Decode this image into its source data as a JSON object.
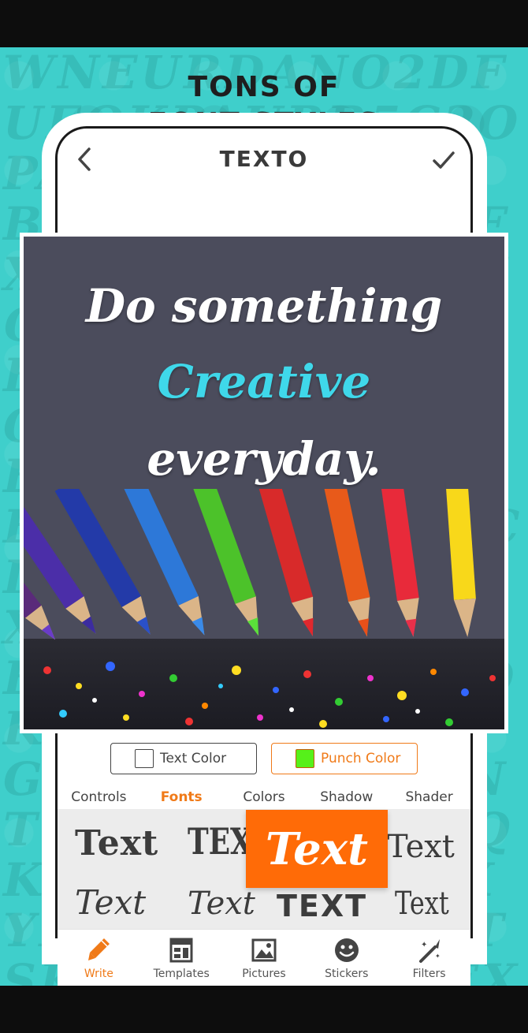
{
  "promo": {
    "headline_line1": "TONS OF",
    "headline_line2": "FONT STYLES",
    "background_letters": "WNEURDANO2DFUEOKPAURB5C2OPAURBSWGHEFABKXSWGHONEBFXYRACFBBXYHTFQEKFUEOGHSWABPLDKNERTIAUCOHRPYSHQBZ2NEOMAVPXGACLTIESKYSPINQUNWCDEOABVMLZIJOEXPTGSQCDAZIOVESCFRHMCXBLJQKPMTEGOWYAJXGEFTZAIRHGCVNTQGWMBRYHTFQKOCLZKHEWBFXYRACFBBXEFTDTSKCEFHLWLNSEXAWRBNUSKPXFCDODOPXQAOGHCDQHRKAMXBWFHRAZPYTEGMDZ"
  },
  "app": {
    "title": "TEXTO",
    "icons": {
      "back": "chevron-left-icon",
      "confirm": "checkmark-icon"
    }
  },
  "canvas": {
    "line1": "Do something",
    "line2": "Creative",
    "line3": "everyday.",
    "colors": {
      "background": "#4b4c5c",
      "highlight": "#3fd8ea",
      "text": "#ffffff"
    }
  },
  "color_buttons": {
    "text_color_label": "Text Color",
    "punch_color_label": "Punch Color",
    "punch_swatch": "#56f01a",
    "accent": "#f07a18"
  },
  "tabs": [
    {
      "label": "Controls",
      "active": false
    },
    {
      "label": "Fonts",
      "active": true
    },
    {
      "label": "Colors",
      "active": false
    },
    {
      "label": "Shadow",
      "active": false
    },
    {
      "label": "Shader",
      "active": false
    }
  ],
  "fonts": {
    "samples": [
      "Text",
      "TEXT",
      "Text",
      "Text",
      "Text",
      "Text",
      "TEXT",
      "Text"
    ],
    "selected_index": 2,
    "selected_bg": "#ff6b07"
  },
  "nav": [
    {
      "label": "Write",
      "icon": "pencil-icon",
      "active": true
    },
    {
      "label": "Templates",
      "icon": "templates-icon",
      "active": false
    },
    {
      "label": "Pictures",
      "icon": "picture-icon",
      "active": false
    },
    {
      "label": "Stickers",
      "icon": "smiley-icon",
      "active": false
    },
    {
      "label": "Filters",
      "icon": "magic-wand-icon",
      "active": false
    }
  ]
}
